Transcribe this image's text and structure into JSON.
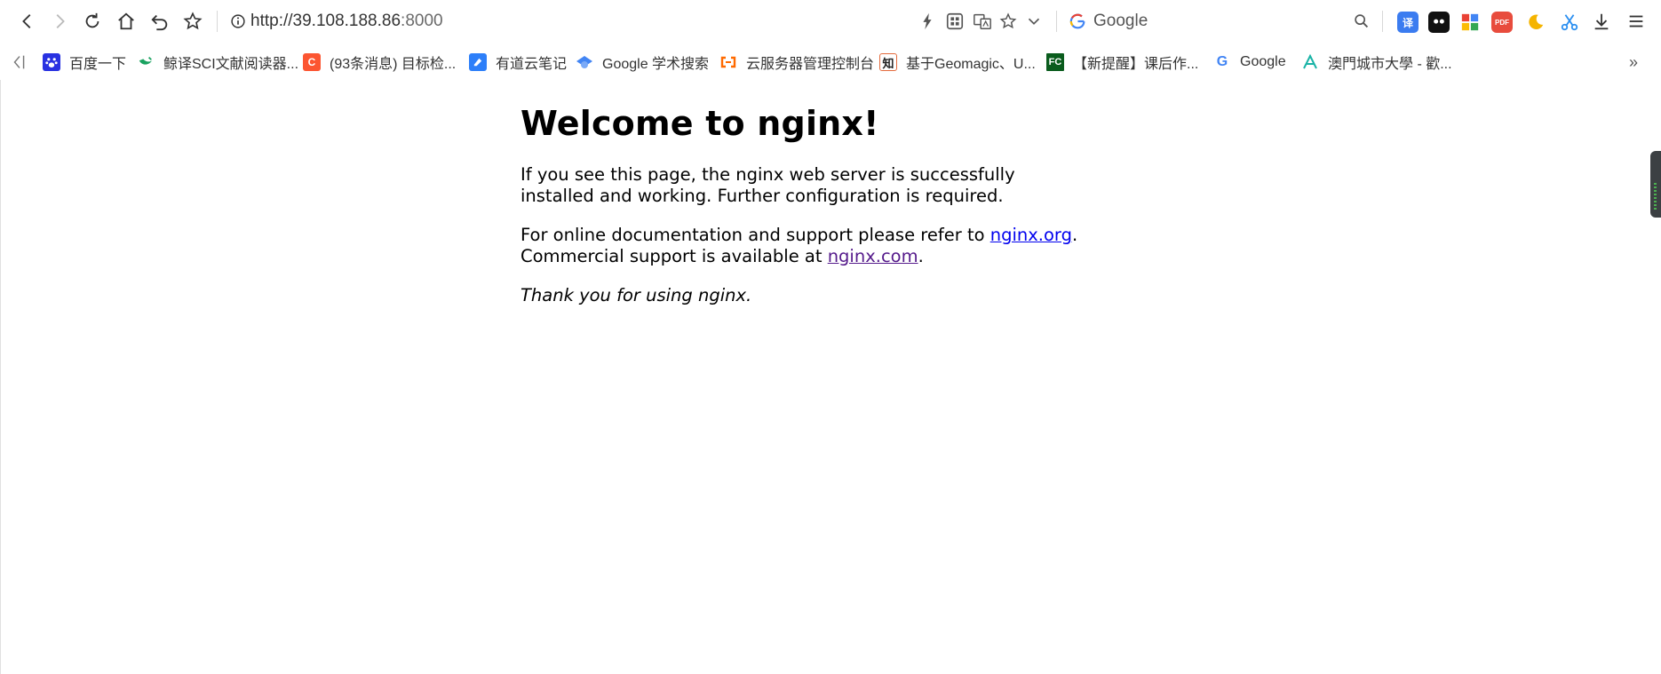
{
  "browser": {
    "url_host": "http://39.108.188.86",
    "url_port": ":8000",
    "search_engine": "Google"
  },
  "extensions": [
    {
      "icon": "translate-ext-icon",
      "label": "译",
      "color": "#3b7cf0"
    },
    {
      "icon": "ghost-ext-icon",
      "label": "",
      "color": "#111111"
    },
    {
      "icon": "grid-ext-icon",
      "label": "",
      "color": "#ffffff"
    },
    {
      "icon": "pdf-ext-icon",
      "label": "PDF",
      "color": "#e84c3d"
    },
    {
      "icon": "moon-ext-icon",
      "label": "",
      "color": "#ffffff"
    },
    {
      "icon": "scissors-ext-icon",
      "label": "",
      "color": "#ffffff"
    }
  ],
  "bookmarks": [
    {
      "label": "百度一下",
      "icon": "baidu-paw-icon"
    },
    {
      "label": "鲸译SCI文献阅读器...",
      "icon": "whale-icon"
    },
    {
      "label": "(93条消息) 目标检...",
      "icon": "csdn-icon"
    },
    {
      "label": "有道云笔记",
      "icon": "youdao-note-icon"
    },
    {
      "label": "Google 学术搜索",
      "icon": "scholar-icon"
    },
    {
      "label": "云服务器管理控制台",
      "icon": "aliyun-icon"
    },
    {
      "label": "基于Geomagic、U...",
      "icon": "zhihu-icon"
    },
    {
      "label": "【新提醒】课后作...",
      "icon": "fc-icon"
    },
    {
      "label": "Google",
      "icon": "google-icon"
    },
    {
      "label": "澳門城市大學 - 歡...",
      "icon": "cityu-icon"
    }
  ],
  "favicon_text": {
    "csdn": "C",
    "zhihu": "知",
    "fc": "FC",
    "google": "G"
  },
  "more_bookmarks": "»",
  "page": {
    "title": "Welcome to nginx!",
    "para1": "If you see this page, the nginx web server is successfully installed and working. Further configuration is required.",
    "para2_prefix": "For online documentation and support please refer to ",
    "link1": "nginx.org",
    "para2_mid": ".",
    "para2_line2": "Commercial support is available at ",
    "link2": "nginx.com",
    "para2_end": ".",
    "thanks": "Thank you for using nginx."
  },
  "colors": {
    "link": "#0000ee",
    "visited_link": "#551a8b"
  }
}
